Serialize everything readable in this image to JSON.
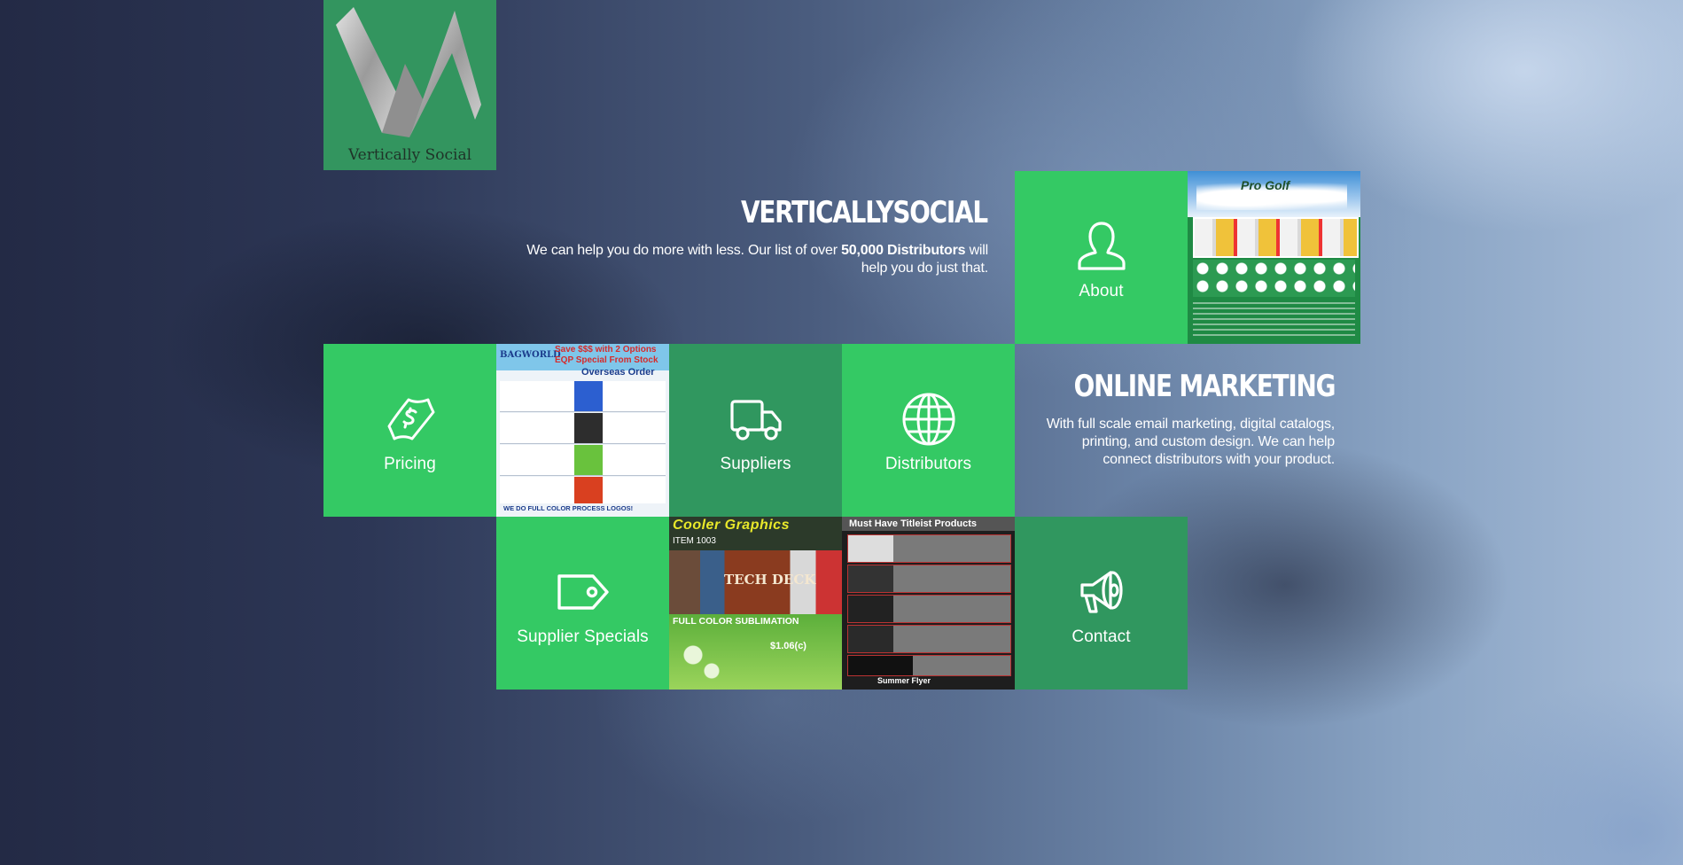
{
  "logo": {
    "text": "Vertically Social"
  },
  "about_section": {
    "title": "VERTICALLYSOCIAL",
    "blurb_before": "We can help you do more with less. Our list of over ",
    "blurb_bold": "50,000 Distributors",
    "blurb_after": " will help you do just that."
  },
  "marketing_section": {
    "title": "ONLINE MARKETING",
    "blurb": "With full scale email marketing, digital catalogs, printing, and custom design. We can help connect distributors with your product."
  },
  "nav": {
    "about": {
      "label": "About",
      "icon": "user-icon"
    },
    "pricing": {
      "label": "Pricing",
      "icon": "money-icon"
    },
    "suppliers": {
      "label": "Suppliers",
      "icon": "truck-icon"
    },
    "distributors": {
      "label": "Distributors",
      "icon": "globe-icon"
    },
    "supplier_specials": {
      "label": "Supplier Specials",
      "icon": "tag-icon"
    },
    "contact": {
      "label": "Contact",
      "icon": "megaphone-icon"
    }
  },
  "promos": {
    "golf": {
      "title": "Pro Golf"
    },
    "bagworld": {
      "brand": "BAGWORLD",
      "headline": "Save $$$ with 2 Options",
      "sub1": "EQP Special From Stock",
      "sub2": "Overseas Order",
      "footer": "WE DO FULL COLOR PROCESS LOGOS!"
    },
    "cooler": {
      "title": "Cooler Graphics",
      "item": "ITEM 1003",
      "product": "TECH DECK",
      "footer": "FULL COLOR SUBLIMATION",
      "price": "$1.06(c)"
    },
    "titleist": {
      "title": "Must Have Titleist Products",
      "footer": "Summer Flyer"
    }
  },
  "colors": {
    "tile_light": "#34c964",
    "tile_dark": "#30975f"
  }
}
